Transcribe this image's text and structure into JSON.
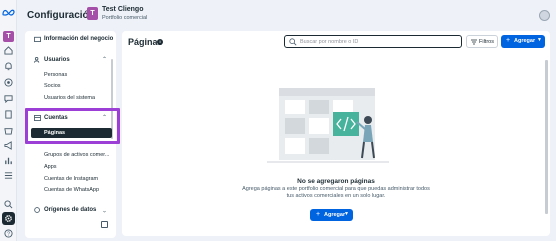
{
  "header": {
    "title": "Configuración",
    "business_initial": "T",
    "business_name": "Test Cliengo",
    "business_subtitle": "Portfolio comercial"
  },
  "rail": {
    "avatar_initial": "T"
  },
  "sidebar": {
    "business_info": "Información del negocio",
    "users_section": {
      "label": "Usuarios",
      "items": [
        "Personas",
        "Socios",
        "Usuarios del sistema"
      ]
    },
    "accounts_section": {
      "label": "Cuentas",
      "selected": "Páginas",
      "items": [
        "Grupos de activos comer...",
        "Apps",
        "Cuentas de Instagram",
        "Cuentas de WhatsApp"
      ]
    },
    "data_sources": "Orígenes de datos"
  },
  "main": {
    "title": "Páginas",
    "search_placeholder": "Buscar por nombre o ID",
    "filters_label": "Filtros",
    "add_label": "Agregar",
    "empty_title": "No se agregaron páginas",
    "empty_desc_line1": "Agrega páginas a este portfolio comercial para que puedas administrar todos",
    "empty_desc_line2": "tus activos comerciales en un solo lugar.",
    "add_label_bottom": "Agregar"
  },
  "colors": {
    "accent": "#0064e0",
    "highlight": "#9b3fd6",
    "avatar": "#a64fa8",
    "selected_bg": "#1c2b33"
  }
}
